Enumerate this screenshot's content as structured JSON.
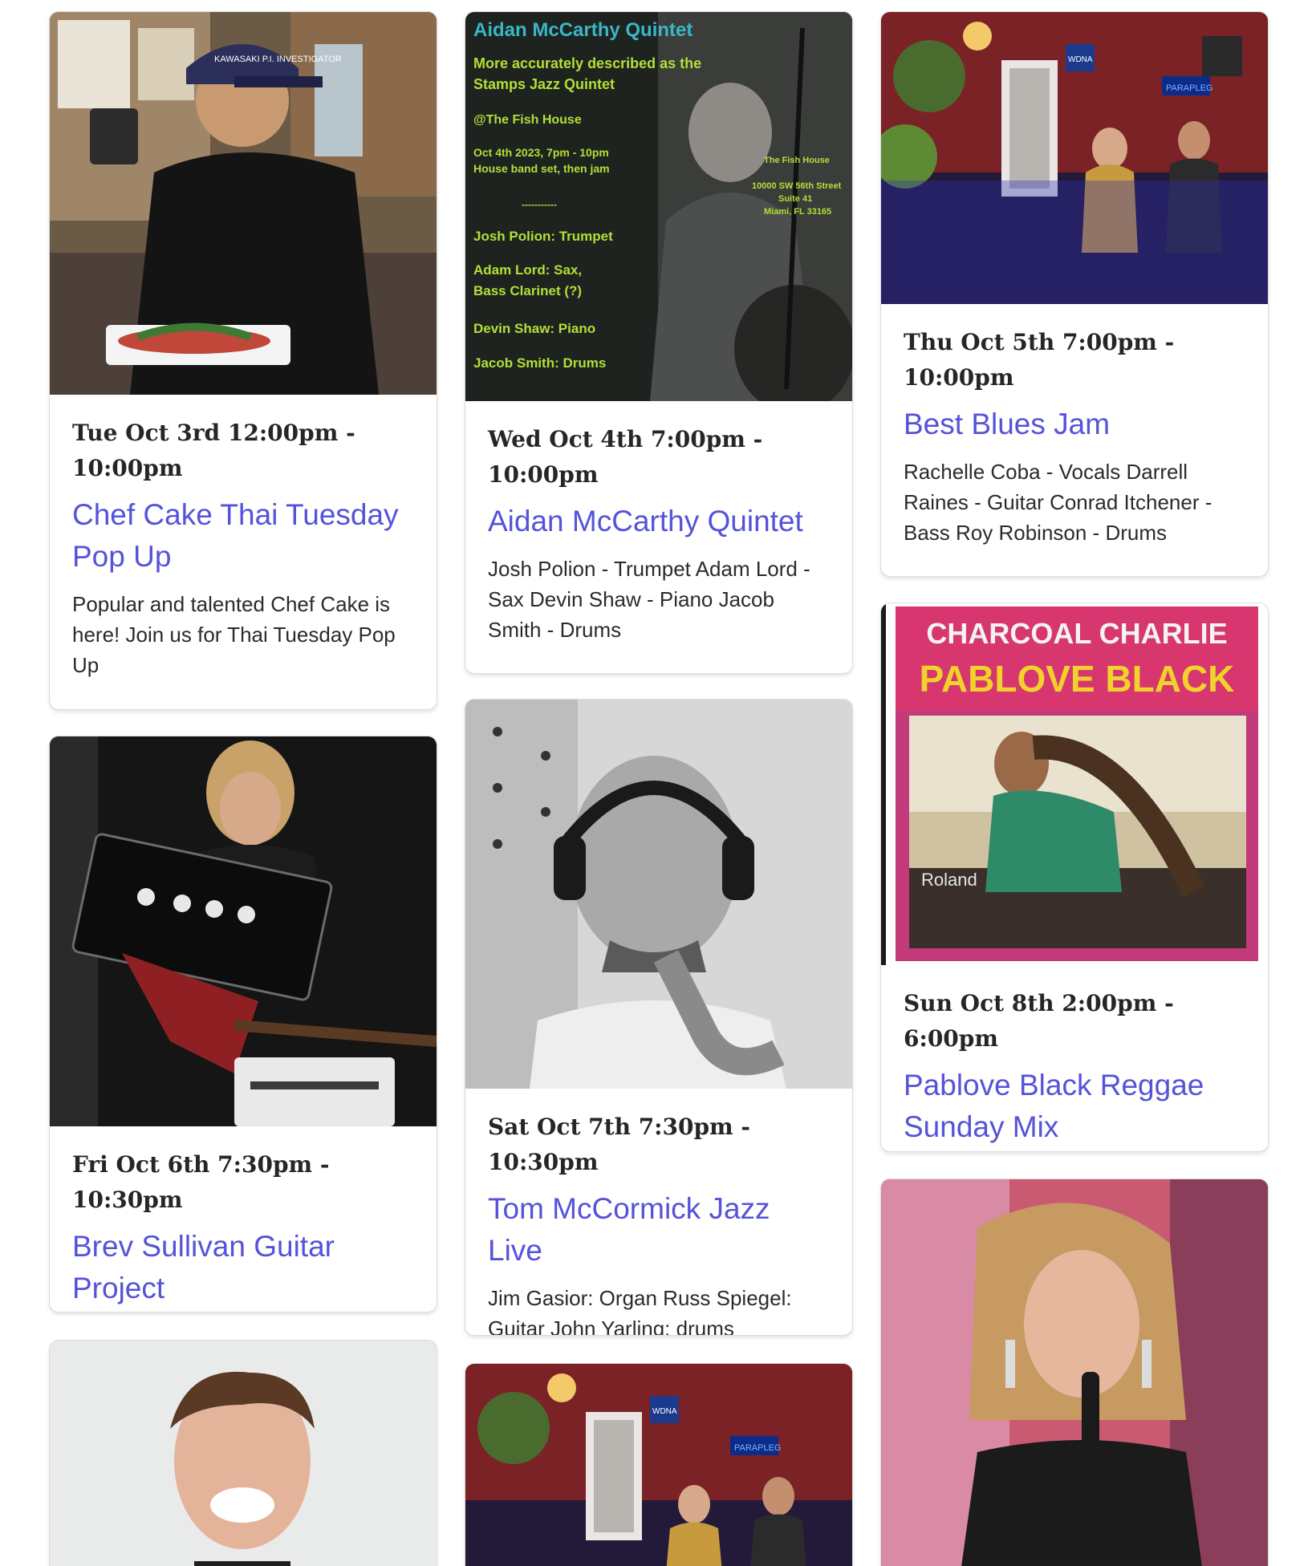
{
  "events": [
    {
      "date": "Tue Oct 3rd 12:00pm - 10:00pm",
      "title": "Chef Cake Thai Tuesday Pop Up",
      "description": "Popular and talented Chef Cake is here! Join us for Thai Tuesday Pop Up",
      "image": "chef-holding-plate-photo",
      "cap_text": "KAWASAKI P.I. INVESTIGATOR"
    },
    {
      "date": "Wed Oct 4th 7:00pm - 10:00pm",
      "title": "Aidan McCarthy Quintet",
      "description": "Josh Polion - Trumpet Adam Lord - Sax Devin Shaw - Piano Jacob Smith - Drums",
      "image": "jazz-quintet-poster",
      "poster": {
        "heading": "Aidan McCarthy Quintet",
        "line1": "More accurately described as the",
        "line2": "Stamps Jazz Quintet",
        "venue": "@The Fish House",
        "when1": "Oct 4th 2023, 7pm - 10pm",
        "when2": "House band set, then jam",
        "divider": "-----------",
        "addr1": "The Fish House",
        "addr2": "10000 SW 56th Street",
        "addr3": "Suite 41",
        "addr4": "Miami, FL 33165",
        "member1": "Josh Polion: Trumpet",
        "member2a": "Adam Lord: Sax,",
        "member2b": "Bass Clarinet (?)",
        "member3": "Devin Shaw: Piano",
        "member4": "Jacob Smith: Drums"
      }
    },
    {
      "date": "Thu Oct 5th 7:00pm - 10:00pm",
      "title": "Best Blues Jam",
      "description": "Rachelle Coba - Vocals Darrell Raines - Guitar Conrad Itchener - Bass Roy Robinson - Drums",
      "image": "band-on-stage-photo",
      "sign1": "WDNA",
      "sign2": "PARAPLEG"
    },
    {
      "date": "Fri Oct 6th 7:30pm - 10:30pm",
      "title": "Brev Sullivan Guitar Project",
      "description": "",
      "image": "guitarist-with-amp-photo"
    },
    {
      "date": "Sat Oct 7th 7:30pm - 10:30pm",
      "title": "Tom McCormick Jazz Live",
      "description": "Jim Gasior: Organ Russ Spiegel: Guitar John Yarling: drums",
      "image": "saxophonist-headphones-photo"
    },
    {
      "date": "Sun Oct 8th 2:00pm - 6:00pm",
      "title": "Pablove Black Reggae Sunday Mix",
      "description": "",
      "image": "reggae-album-cover",
      "cover": {
        "top": "CHARCOAL CHARLIE",
        "name": "PABLOVE BLACK",
        "brand": "Roland"
      }
    },
    {
      "image": "smiling-young-man-photo"
    },
    {
      "image": "band-on-stage-photo",
      "sign1": "WDNA",
      "sign2": "PARAPLEG"
    },
    {
      "image": "singer-with-microphone-photo"
    }
  ],
  "colors": {
    "title_link": "#5553d8",
    "date_text": "#262626",
    "body_text": "#2b2b2b",
    "card_border": "#dcdcdc"
  }
}
